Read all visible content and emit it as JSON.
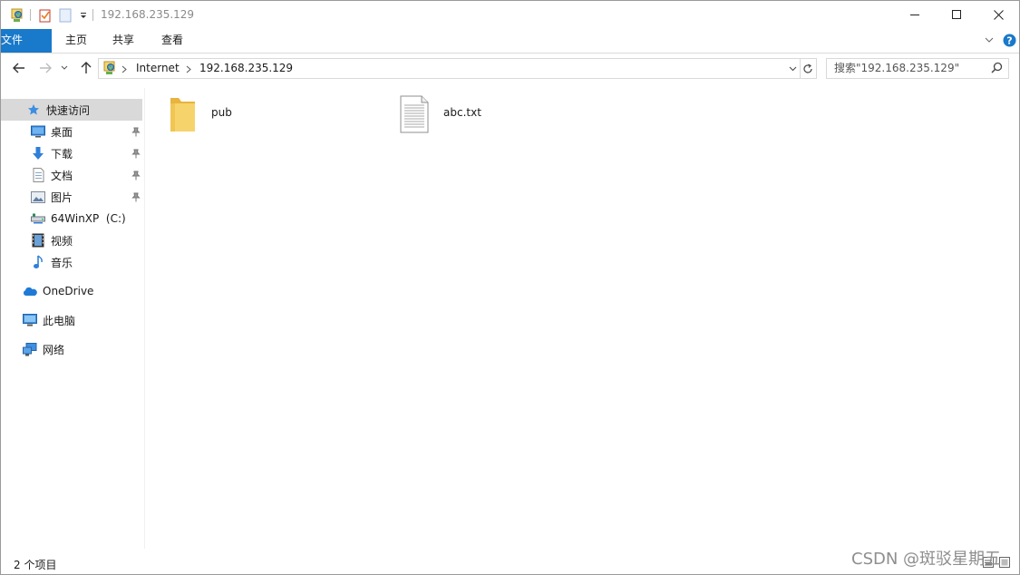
{
  "window": {
    "title": "192.168.235.129",
    "minimize_icon": "minimize-icon",
    "maximize_icon": "maximize-icon",
    "close_icon": "close-icon"
  },
  "quick_access_toolbar": {
    "icons": [
      "network-location-icon",
      "properties-icon",
      "new-folder-icon",
      "customize-dropdown-icon"
    ]
  },
  "ribbon": {
    "tabs": [
      {
        "label": "文件"
      },
      {
        "label": "主页"
      },
      {
        "label": "共享"
      },
      {
        "label": "查看"
      }
    ],
    "expand_icon": "chevron-down-icon",
    "help_icon": "help-icon"
  },
  "navigation": {
    "breadcrumb": [
      "Internet",
      "192.168.235.129"
    ],
    "search_placeholder": "搜索\"192.168.235.129\""
  },
  "sidebar": {
    "quick_access_label": "快速访问",
    "items": [
      {
        "label": "桌面",
        "icon": "desktop-icon",
        "pinned": true
      },
      {
        "label": "下载",
        "icon": "download-icon",
        "pinned": true
      },
      {
        "label": "文档",
        "icon": "documents-icon",
        "pinned": true
      },
      {
        "label": "图片",
        "icon": "pictures-icon",
        "pinned": true
      },
      {
        "label": "64WinXP  (C:)",
        "icon": "network-drive-icon",
        "pinned": false
      },
      {
        "label": "视频",
        "icon": "videos-icon",
        "pinned": false
      },
      {
        "label": "音乐",
        "icon": "music-icon",
        "pinned": false
      }
    ],
    "onedrive_label": "OneDrive",
    "this_pc_label": "此电脑",
    "network_label": "网络"
  },
  "content": {
    "items": [
      {
        "name": "pub",
        "type": "folder"
      },
      {
        "name": "abc.txt",
        "type": "text-file"
      }
    ]
  },
  "status": {
    "item_count": "2 个项目"
  },
  "watermark": "CSDN @斑驳星期五",
  "colors": {
    "file_tab": "#1979ca",
    "folder": "#f2c94c",
    "selected": "#d9d9d9"
  }
}
